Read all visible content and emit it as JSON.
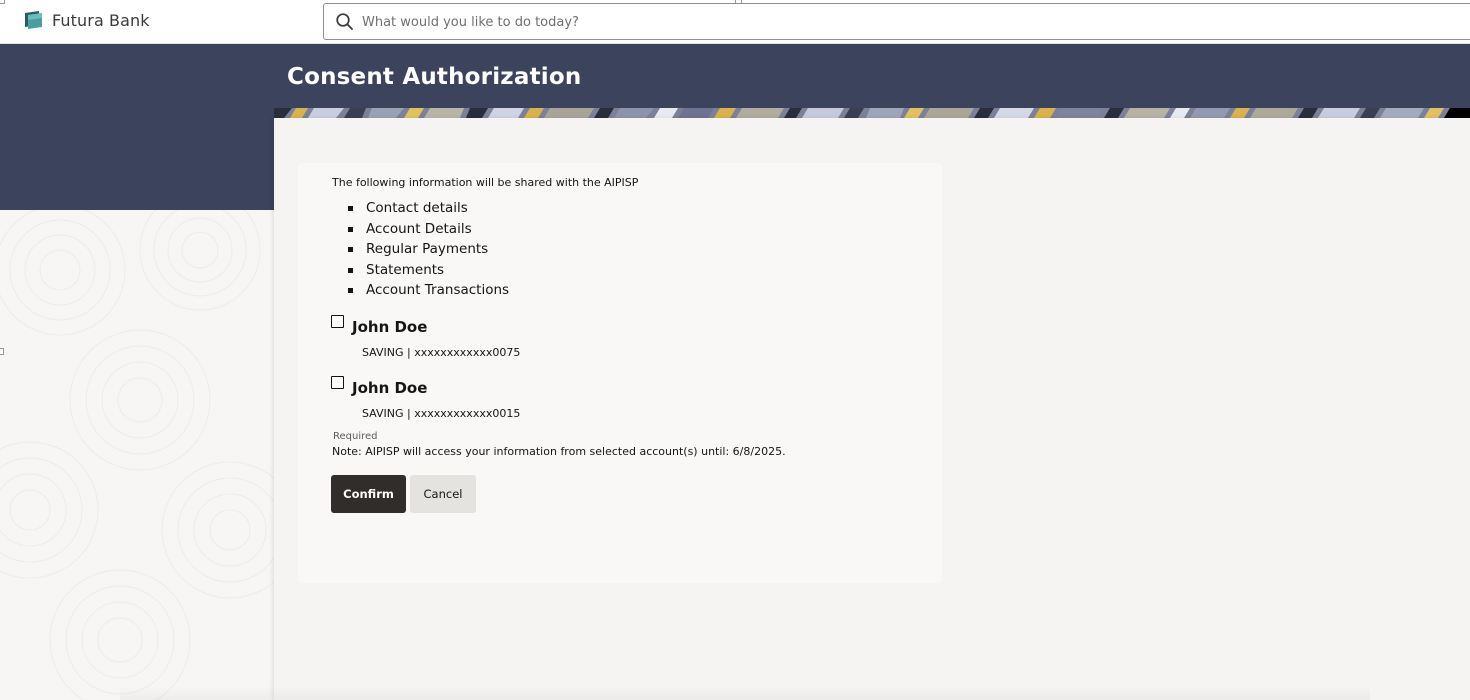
{
  "header": {
    "brand_name": "Futura Bank",
    "search_placeholder": "What would you like to do today?"
  },
  "page": {
    "title": "Consent Authorization"
  },
  "consent": {
    "intro": "The following information will be shared with the AIPISP",
    "items": [
      "Contact details",
      "Account Details",
      "Regular Payments",
      "Statements",
      "Account Transactions"
    ],
    "accounts": [
      {
        "name": "John Doe",
        "detail": "SAVING | xxxxxxxxxxxx0075",
        "checked": false
      },
      {
        "name": "John Doe",
        "detail": "SAVING | xxxxxxxxxxxx0015",
        "checked": false
      }
    ],
    "required_label": "Required",
    "note": "Note: AIPISP will access your information from selected account(s) until: 6/8/2025."
  },
  "actions": {
    "confirm_label": "Confirm",
    "cancel_label": "Cancel"
  },
  "colors": {
    "banner": "#3b435d",
    "primary_button": "#312d2a",
    "secondary_button": "#e5e3e0",
    "logo_accent": "#2f7a7d"
  },
  "icons": {
    "logo": "futura-bank-logo",
    "search": "search-icon"
  }
}
